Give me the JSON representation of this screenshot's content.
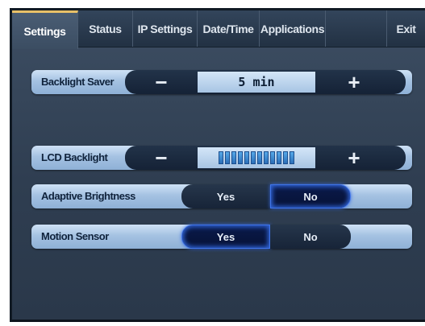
{
  "tabs": [
    {
      "label": "Settings",
      "active": true
    },
    {
      "label": "Status",
      "active": false
    },
    {
      "label": "IP Settings",
      "active": false
    },
    {
      "label": "Date/Time",
      "active": false
    },
    {
      "label": "Applications",
      "active": false
    },
    {
      "label": "",
      "active": false
    },
    {
      "label": "Exit",
      "active": false
    }
  ],
  "backlight_saver": {
    "label": "Backlight Saver",
    "minus": "−",
    "value": "5 min",
    "plus": "+"
  },
  "lcd_backlight": {
    "label": "LCD Backlight",
    "minus": "−",
    "plus": "+",
    "level": 0.75
  },
  "adaptive_brightness": {
    "label": "Adaptive Brightness",
    "yes": "Yes",
    "no": "No",
    "selected": "No"
  },
  "motion_sensor": {
    "label": "Motion Sensor",
    "yes": "Yes",
    "no": "No",
    "selected": "Yes"
  },
  "colors": {
    "accent": "#e8c067",
    "selected_glow": "#3f74ea"
  }
}
